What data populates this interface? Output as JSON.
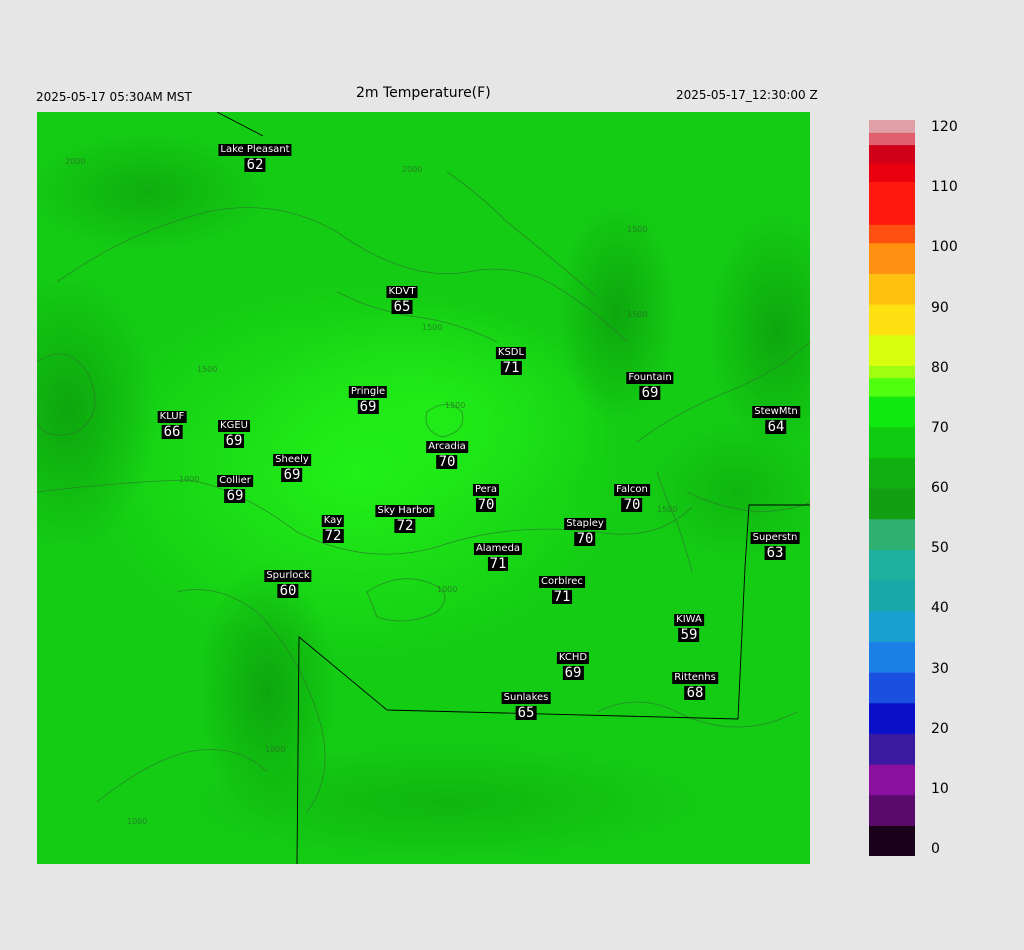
{
  "header": {
    "local_time": "2025-05-17 05:30AM MST",
    "title": "2m Temperature(F)",
    "valid_time": "2025-05-17_12:30:00 Z"
  },
  "stations": [
    {
      "name": "Lake Pleasant",
      "value": "62"
    },
    {
      "name": "KDVT",
      "value": "65"
    },
    {
      "name": "KSDL",
      "value": "71"
    },
    {
      "name": "Fountain",
      "value": "69"
    },
    {
      "name": "Pringle",
      "value": "69"
    },
    {
      "name": "StewMtn",
      "value": "64"
    },
    {
      "name": "KLUF",
      "value": "66"
    },
    {
      "name": "KGEU",
      "value": "69"
    },
    {
      "name": "Arcadia",
      "value": "70"
    },
    {
      "name": "Sheely",
      "value": "69"
    },
    {
      "name": "Collier",
      "value": "69"
    },
    {
      "name": "Pera",
      "value": "70"
    },
    {
      "name": "Falcon",
      "value": "70"
    },
    {
      "name": "Kay",
      "value": "72"
    },
    {
      "name": "Sky Harbor",
      "value": "72"
    },
    {
      "name": "Stapley",
      "value": "70"
    },
    {
      "name": "Superstn",
      "value": "63"
    },
    {
      "name": "Alameda",
      "value": "71"
    },
    {
      "name": "Spurlock",
      "value": "60"
    },
    {
      "name": "Corblrec",
      "value": "71"
    },
    {
      "name": "KIWA",
      "value": "59"
    },
    {
      "name": "KCHD",
      "value": "69"
    },
    {
      "name": "Rittenhs",
      "value": "68"
    },
    {
      "name": "Sunlakes",
      "value": "65"
    }
  ],
  "contour_labels": [
    "2000",
    "2000",
    "1500",
    "1500",
    "1500",
    "1500",
    "1000",
    "1000",
    "1000",
    "1000",
    "1500",
    "2000",
    "1500"
  ],
  "colorbar": {
    "ticks": [
      "120",
      "110",
      "100",
      "90",
      "80",
      "70",
      "60",
      "50",
      "40",
      "30",
      "20",
      "10",
      "0"
    ],
    "min": 0,
    "max": 120
  }
}
